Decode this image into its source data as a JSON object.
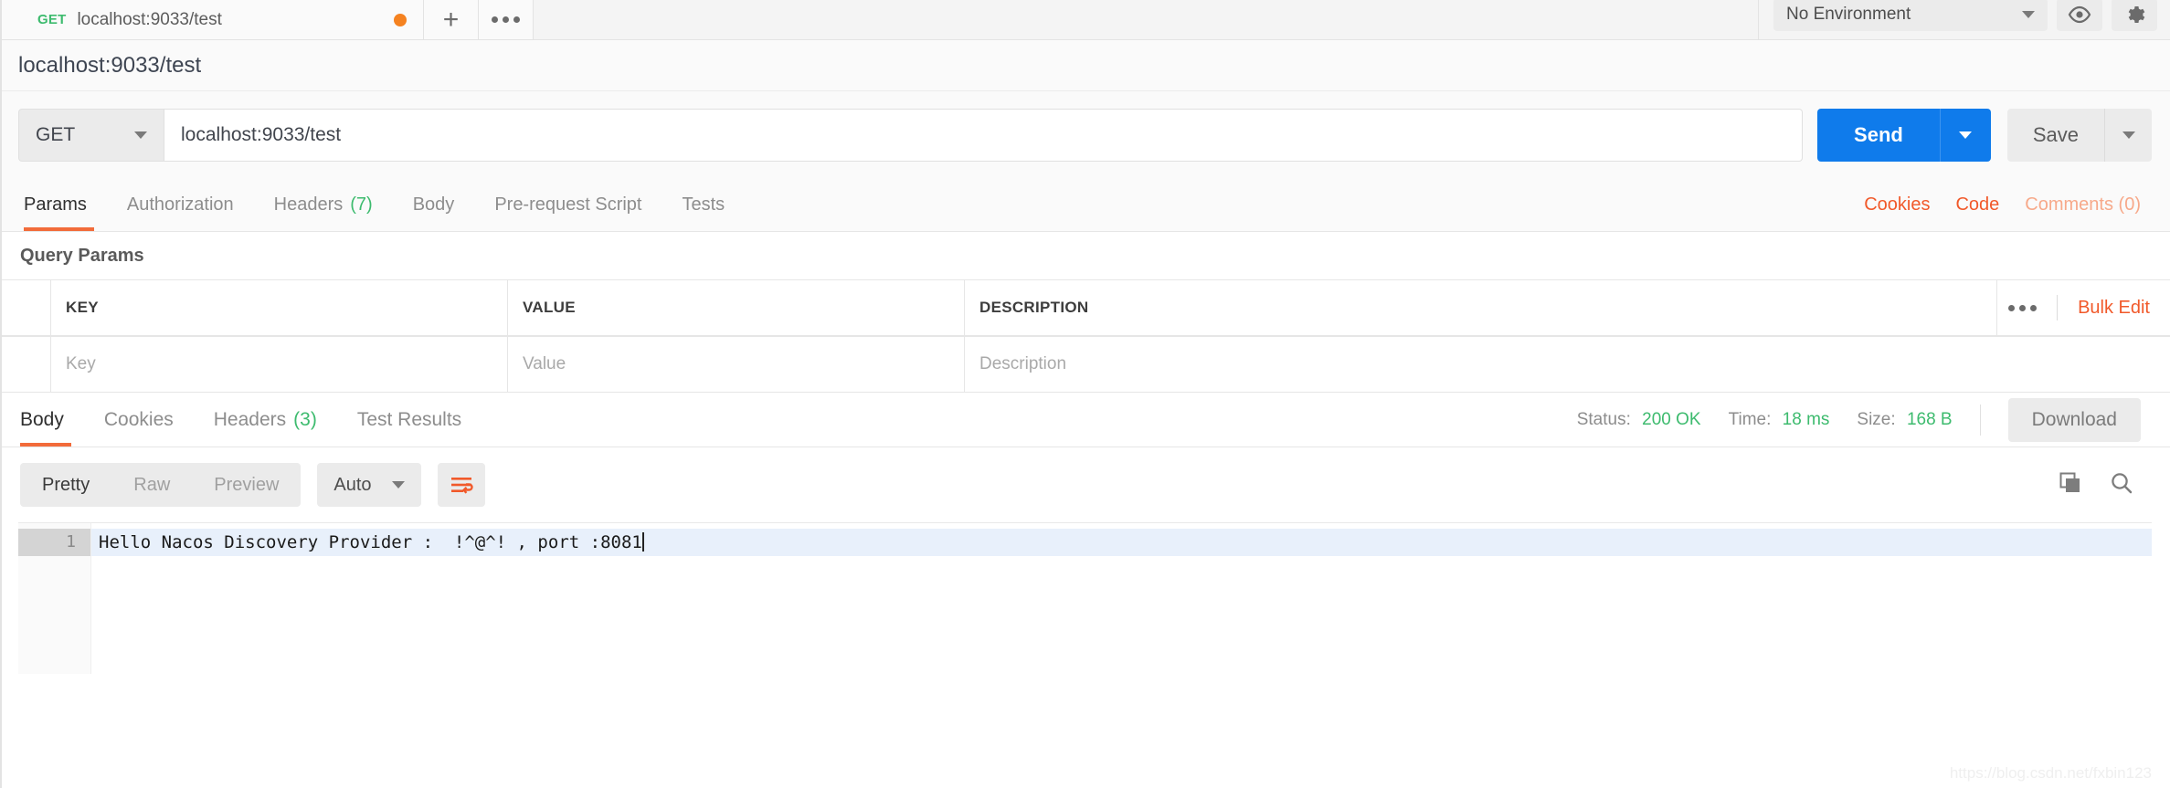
{
  "tabbar": {
    "active_tab": {
      "method": "GET",
      "title": "localhost:9033/test",
      "unsaved": true
    },
    "new_tab_label": "+",
    "more_label": "•••",
    "environment": {
      "selected": "No Environment"
    },
    "eye_icon": "eye-icon",
    "gear_icon": "gear-icon"
  },
  "request": {
    "title": "localhost:9033/test",
    "method": "GET",
    "url": "localhost:9033/test",
    "send_label": "Send",
    "save_label": "Save",
    "tabs": [
      {
        "label": "Params",
        "count": "",
        "active": true
      },
      {
        "label": "Authorization",
        "count": "",
        "active": false
      },
      {
        "label": "Headers",
        "count": "(7)",
        "active": false
      },
      {
        "label": "Body",
        "count": "",
        "active": false
      },
      {
        "label": "Pre-request Script",
        "count": "",
        "active": false
      },
      {
        "label": "Tests",
        "count": "",
        "active": false
      }
    ],
    "right_links": [
      {
        "label": "Cookies",
        "muted": false
      },
      {
        "label": "Code",
        "muted": false
      },
      {
        "label": "Comments (0)",
        "muted": true
      }
    ]
  },
  "query_params": {
    "section_title": "Query Params",
    "columns": [
      "KEY",
      "VALUE",
      "DESCRIPTION"
    ],
    "placeholder_row": {
      "key": "Key",
      "value": "Value",
      "description": "Description"
    },
    "more_label": "•••",
    "bulk_edit_label": "Bulk Edit"
  },
  "response": {
    "tabs": [
      {
        "label": "Body",
        "count": "",
        "active": true
      },
      {
        "label": "Cookies",
        "count": "",
        "active": false
      },
      {
        "label": "Headers",
        "count": "(3)",
        "active": false
      },
      {
        "label": "Test Results",
        "count": "",
        "active": false
      }
    ],
    "status_label": "Status:",
    "status_value": "200 OK",
    "time_label": "Time:",
    "time_value": "18 ms",
    "size_label": "Size:",
    "size_value": "168 B",
    "download_label": "Download",
    "view_modes": [
      {
        "label": "Pretty",
        "active": true
      },
      {
        "label": "Raw",
        "active": false
      },
      {
        "label": "Preview",
        "active": false
      }
    ],
    "format_selected": "Auto",
    "wrap_icon": "word-wrap-icon",
    "copy_icon": "copy-icon",
    "search_icon": "search-icon",
    "body": {
      "line_numbers": [
        "1"
      ],
      "lines": [
        "Hello Nacos Discovery Provider :  !^@^! , port :8081"
      ]
    }
  },
  "watermark": "https://blog.csdn.net/fxbin123",
  "colors": {
    "accent_orange": "#f1592a",
    "send_blue": "#0f7beb",
    "status_green": "#3dbb6e",
    "unsaved_dot": "#f58220"
  }
}
